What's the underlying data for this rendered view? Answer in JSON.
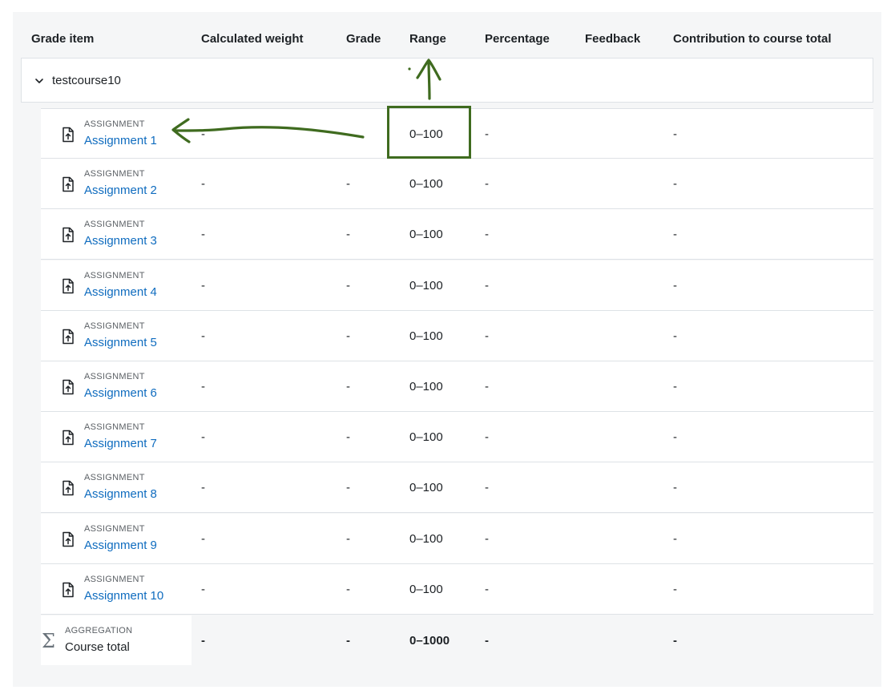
{
  "headers": {
    "grade_item": "Grade item",
    "calculated_weight": "Calculated weight",
    "grade": "Grade",
    "range": "Range",
    "percentage": "Percentage",
    "feedback": "Feedback",
    "contribution": "Contribution to course total"
  },
  "category": {
    "name": "testcourse10",
    "icon": "chevron-down-icon"
  },
  "items": [
    {
      "kind": "ASSIGNMENT",
      "name": "Assignment 1",
      "weight": "-",
      "grade": "",
      "range": "0–100",
      "percentage": "-",
      "feedback": "",
      "contribution": "-"
    },
    {
      "kind": "ASSIGNMENT",
      "name": "Assignment 2",
      "weight": "-",
      "grade": "-",
      "range": "0–100",
      "percentage": "-",
      "feedback": "",
      "contribution": "-"
    },
    {
      "kind": "ASSIGNMENT",
      "name": "Assignment 3",
      "weight": "-",
      "grade": "-",
      "range": "0–100",
      "percentage": "-",
      "feedback": "",
      "contribution": "-"
    },
    {
      "kind": "ASSIGNMENT",
      "name": "Assignment 4",
      "weight": "-",
      "grade": "-",
      "range": "0–100",
      "percentage": "-",
      "feedback": "",
      "contribution": "-"
    },
    {
      "kind": "ASSIGNMENT",
      "name": "Assignment 5",
      "weight": "-",
      "grade": "-",
      "range": "0–100",
      "percentage": "-",
      "feedback": "",
      "contribution": "-"
    },
    {
      "kind": "ASSIGNMENT",
      "name": "Assignment 6",
      "weight": "-",
      "grade": "-",
      "range": "0–100",
      "percentage": "-",
      "feedback": "",
      "contribution": "-"
    },
    {
      "kind": "ASSIGNMENT",
      "name": "Assignment 7",
      "weight": "-",
      "grade": "-",
      "range": "0–100",
      "percentage": "-",
      "feedback": "",
      "contribution": "-"
    },
    {
      "kind": "ASSIGNMENT",
      "name": "Assignment 8",
      "weight": "-",
      "grade": "-",
      "range": "0–100",
      "percentage": "-",
      "feedback": "",
      "contribution": "-"
    },
    {
      "kind": "ASSIGNMENT",
      "name": "Assignment 9",
      "weight": "-",
      "grade": "-",
      "range": "0–100",
      "percentage": "-",
      "feedback": "",
      "contribution": "-"
    },
    {
      "kind": "ASSIGNMENT",
      "name": "Assignment 10",
      "weight": "-",
      "grade": "-",
      "range": "0–100",
      "percentage": "-",
      "feedback": "",
      "contribution": "-"
    }
  ],
  "item_icon": "assignment-upload-icon",
  "total": {
    "kind": "AGGREGATION",
    "name": "Course total",
    "icon": "sigma-icon",
    "weight": "-",
    "grade": "-",
    "range": "0–1000",
    "percentage": "-",
    "contribution": "-"
  },
  "colors": {
    "link": "#0f6cbf",
    "annotation": "#3f6b1f",
    "panel_bg": "#f5f6f7"
  }
}
